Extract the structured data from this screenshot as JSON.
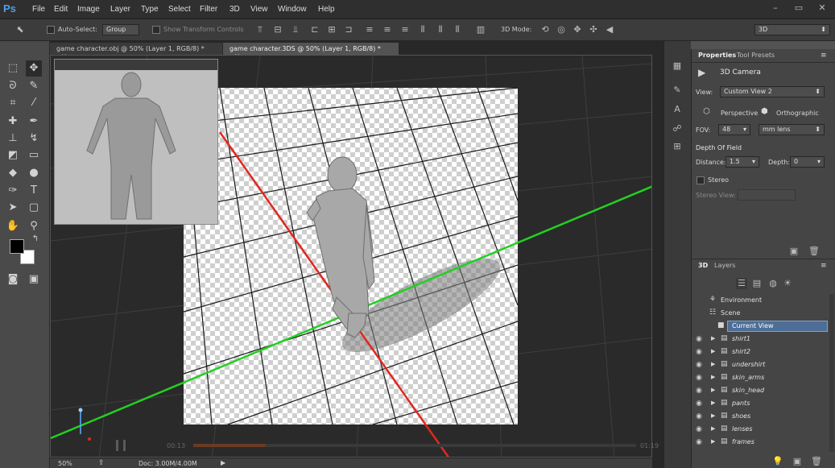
{
  "app": {
    "logo": "Ps"
  },
  "menu": [
    "File",
    "Edit",
    "Image",
    "Layer",
    "Type",
    "Select",
    "Filter",
    "3D",
    "View",
    "Window",
    "Help"
  ],
  "window_controls": {
    "minimize": "–",
    "restore": "▭",
    "close": "✕"
  },
  "options_bar": {
    "auto_select_label": "Auto-Select:",
    "auto_select_value": "Group",
    "show_transform_label": "Show Transform Controls",
    "mode_label": "3D Mode:",
    "workspace_value": "3D"
  },
  "tabs": [
    {
      "label": "game character.obj @ 50% (Layer 1, RGB/8) *",
      "close": "×"
    },
    {
      "label": "game character.3DS @ 50% (Layer 1, RGB/8) *",
      "close": "×"
    }
  ],
  "timeline": {
    "current": "00:13",
    "end": "01:19"
  },
  "status": {
    "zoom": "50%",
    "doc": "Doc: 3.00M/4.00M"
  },
  "properties": {
    "tabs": [
      "Properties",
      "Tool Presets"
    ],
    "section_title": "3D Camera",
    "view_label": "View:",
    "view_value": "Custom View 2",
    "perspective_label": "Perspective",
    "orthographic_label": "Orthographic",
    "fov_label": "FOV:",
    "fov_value": "48",
    "fov_unit": "mm lens",
    "dof_title": "Depth Of Field",
    "distance_label": "Distance:",
    "distance_value": "1.5",
    "depth_label": "Depth:",
    "depth_value": "0",
    "stereo_label": "Stereo",
    "stereo_view_label": "Stereo View:"
  },
  "layers_panel": {
    "tabs": [
      "3D",
      "Layers"
    ],
    "items": [
      {
        "name": "Environment",
        "indent": 0,
        "italic": false,
        "selected": false,
        "eye": false
      },
      {
        "name": "Scene",
        "indent": 0,
        "italic": false,
        "selected": false,
        "eye": false
      },
      {
        "name": "Current View",
        "indent": 1,
        "italic": false,
        "selected": true,
        "eye": false
      },
      {
        "name": "shirt1",
        "indent": 1,
        "italic": true,
        "selected": false,
        "eye": true
      },
      {
        "name": "shirt2",
        "indent": 1,
        "italic": true,
        "selected": false,
        "eye": true
      },
      {
        "name": "undershirt",
        "indent": 1,
        "italic": true,
        "selected": false,
        "eye": true
      },
      {
        "name": "skin_arms",
        "indent": 1,
        "italic": true,
        "selected": false,
        "eye": true
      },
      {
        "name": "skin_head",
        "indent": 1,
        "italic": true,
        "selected": false,
        "eye": true
      },
      {
        "name": "pants",
        "indent": 1,
        "italic": true,
        "selected": false,
        "eye": true
      },
      {
        "name": "shoes",
        "indent": 1,
        "italic": true,
        "selected": false,
        "eye": true
      },
      {
        "name": "lenses",
        "indent": 1,
        "italic": true,
        "selected": false,
        "eye": true
      },
      {
        "name": "frames",
        "indent": 1,
        "italic": true,
        "selected": false,
        "eye": true
      }
    ]
  },
  "colors": {
    "accent": "#4f9fea",
    "selection": "#4d6e96",
    "x_axis": "#e0281e",
    "z_axis": "#22d022"
  }
}
